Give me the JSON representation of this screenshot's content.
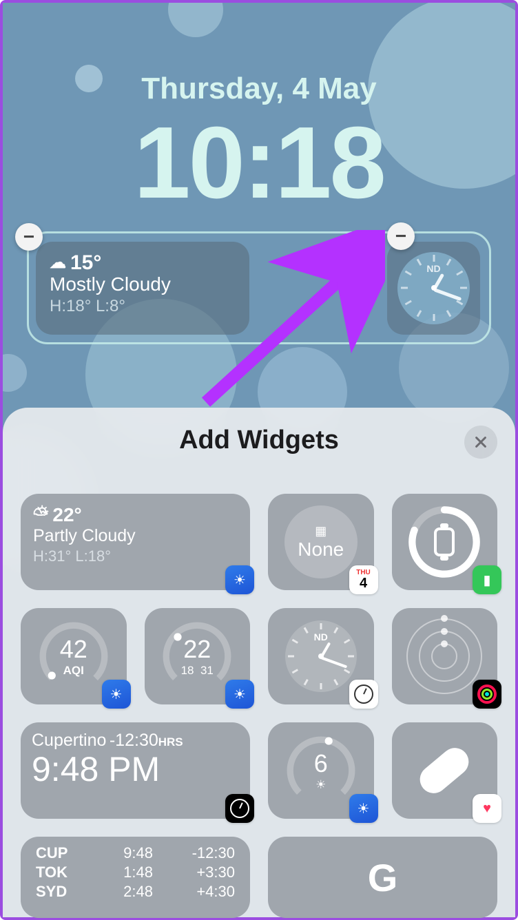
{
  "lockscreen": {
    "date": "Thursday, 4 May",
    "time": "10:18",
    "weather": {
      "icon": "☁︎",
      "temp": "15°",
      "condition": "Mostly Cloudy",
      "high_low": "H:18° L:8°"
    },
    "clock_label": "ND"
  },
  "sheet": {
    "title": "Add Widgets",
    "cal_day": "THU",
    "cal_date": "4",
    "calendar_label": "None",
    "weather2": {
      "icon": "⛅︎",
      "temp": "22°",
      "condition": "Partly Cloudy",
      "high_low": "H:31° L:18°"
    },
    "aqi": {
      "value": "42",
      "label": "AQI"
    },
    "temp_gauge": {
      "value": "22",
      "low": "18",
      "high": "31"
    },
    "clock_label": "ND",
    "uv": {
      "value": "6"
    },
    "world_clock": {
      "city": "Cupertino",
      "offset": "-12:30",
      "hrs": "HRS",
      "time": "9:48 PM"
    },
    "world_table": [
      {
        "c": "CUP",
        "t": "9:48",
        "o": "-12:30"
      },
      {
        "c": "TOK",
        "t": "1:48",
        "o": "+3:30"
      },
      {
        "c": "SYD",
        "t": "2:48",
        "o": "+4:30"
      }
    ],
    "google": "G"
  }
}
